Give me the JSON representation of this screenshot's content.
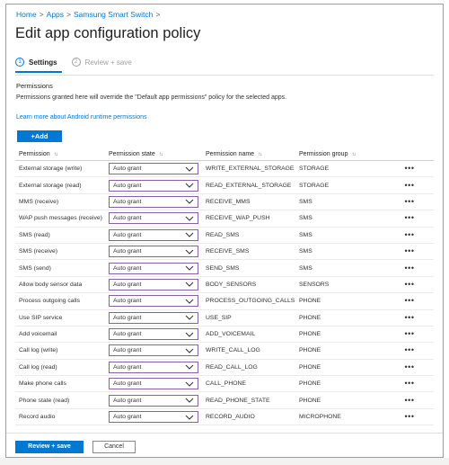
{
  "breadcrumb": {
    "items": [
      "Home",
      "Apps",
      "Samsung Smart Switch"
    ],
    "separator": ">"
  },
  "page": {
    "title": "Edit app configuration policy"
  },
  "steps": [
    {
      "number": "1",
      "label": "Settings",
      "active": true
    },
    {
      "number": "2",
      "label": "Review + save",
      "active": false
    }
  ],
  "permissions_section": {
    "heading": "Permissions",
    "description": "Permissions granted here will override the \"Default app permissions\" policy for the selected apps.",
    "learn_more": "Learn more about Android runtime permissions",
    "add_label": "+Add"
  },
  "table": {
    "columns": [
      "Permission",
      "Permission state",
      "Permission name",
      "Permission group"
    ],
    "rows": [
      {
        "permission": "External storage (write)",
        "state": "Auto grant",
        "name": "WRITE_EXTERNAL_STORAGE",
        "group": "STORAGE"
      },
      {
        "permission": "External storage (read)",
        "state": "Auto grant",
        "name": "READ_EXTERNAL_STORAGE",
        "group": "STORAGE"
      },
      {
        "permission": "MMS (receive)",
        "state": "Auto grant",
        "name": "RECEIVE_MMS",
        "group": "SMS"
      },
      {
        "permission": "WAP push messages (receive)",
        "state": "Auto grant",
        "name": "RECEIVE_WAP_PUSH",
        "group": "SMS"
      },
      {
        "permission": "SMS (read)",
        "state": "Auto grant",
        "name": "READ_SMS",
        "group": "SMS"
      },
      {
        "permission": "SMS (receive)",
        "state": "Auto grant",
        "name": "RECEIVE_SMS",
        "group": "SMS"
      },
      {
        "permission": "SMS (send)",
        "state": "Auto grant",
        "name": "SEND_SMS",
        "group": "SMS"
      },
      {
        "permission": "Allow body sensor data",
        "state": "Auto grant",
        "name": "BODY_SENSORS",
        "group": "SENSORS"
      },
      {
        "permission": "Process outgoing calls",
        "state": "Auto grant",
        "name": "PROCESS_OUTGOING_CALLS",
        "group": "PHONE"
      },
      {
        "permission": "Use SIP service",
        "state": "Auto grant",
        "name": "USE_SIP",
        "group": "PHONE"
      },
      {
        "permission": "Add voicemail",
        "state": "Auto grant",
        "name": "ADD_VOICEMAIL",
        "group": "PHONE"
      },
      {
        "permission": "Call log (write)",
        "state": "Auto grant",
        "name": "WRITE_CALL_LOG",
        "group": "PHONE"
      },
      {
        "permission": "Call log (read)",
        "state": "Auto grant",
        "name": "READ_CALL_LOG",
        "group": "PHONE"
      },
      {
        "permission": "Make phone calls",
        "state": "Auto grant",
        "name": "CALL_PHONE",
        "group": "PHONE"
      },
      {
        "permission": "Phone state (read)",
        "state": "Auto grant",
        "name": "READ_PHONE_STATE",
        "group": "PHONE"
      },
      {
        "permission": "Record audio",
        "state": "Auto grant",
        "name": "RECORD_AUDIO",
        "group": "MICROPHONE"
      }
    ]
  },
  "footer": {
    "review_label": "Review + save",
    "cancel_label": "Cancel"
  },
  "colors": {
    "accent": "#0078d4",
    "dropdown_border": "#8a5ea8"
  },
  "icons": {
    "sort": "sort-arrows-icon",
    "chevron": "chevron-down-icon",
    "more": "more-actions-icon"
  }
}
